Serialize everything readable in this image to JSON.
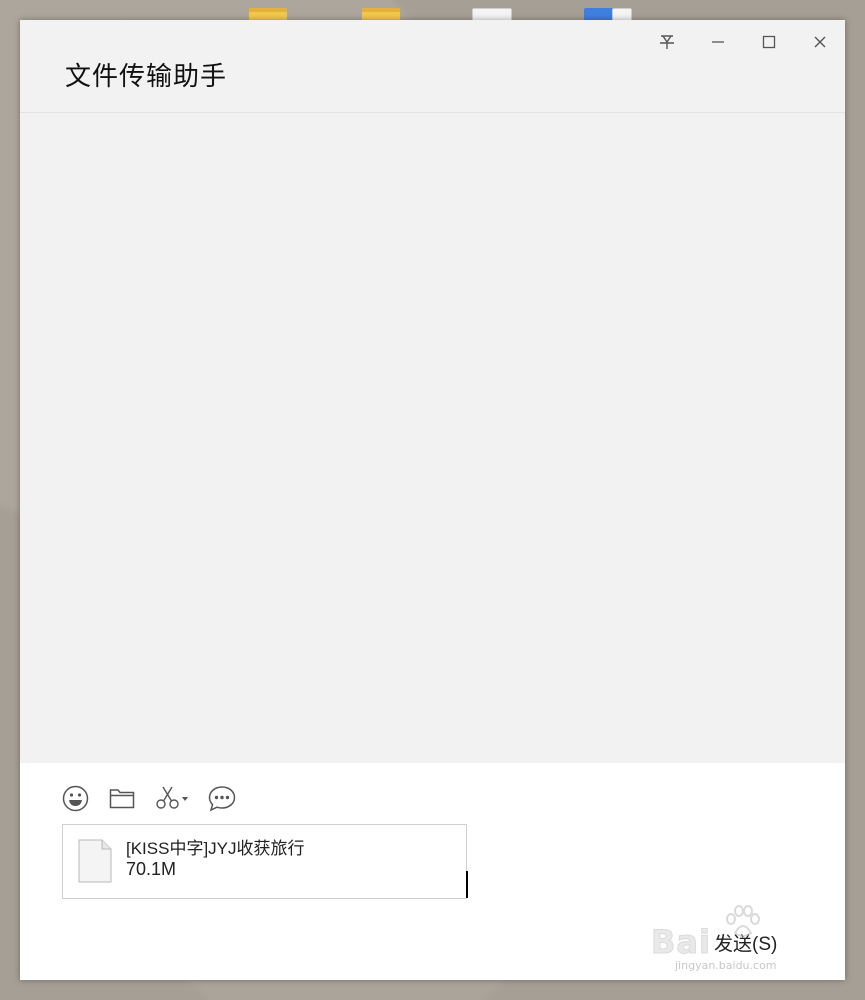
{
  "window": {
    "title": "文件传输助手"
  },
  "title_buttons": {
    "pin_icon": "pin-icon",
    "minimize_icon": "minimize-icon",
    "maximize_icon": "maximize-icon",
    "close_icon": "close-icon"
  },
  "toolbar": {
    "icons": [
      "emoji-icon",
      "folder-icon",
      "scissors-icon",
      "chat-history-icon"
    ]
  },
  "file_attachment": {
    "name": "[KISS中字]JYJ收获旅行",
    "size": "70.1M"
  },
  "send_button": {
    "label": "发送(S)"
  },
  "watermark": {
    "brand": "Bai",
    "url": "jingyan.baidu.com"
  }
}
